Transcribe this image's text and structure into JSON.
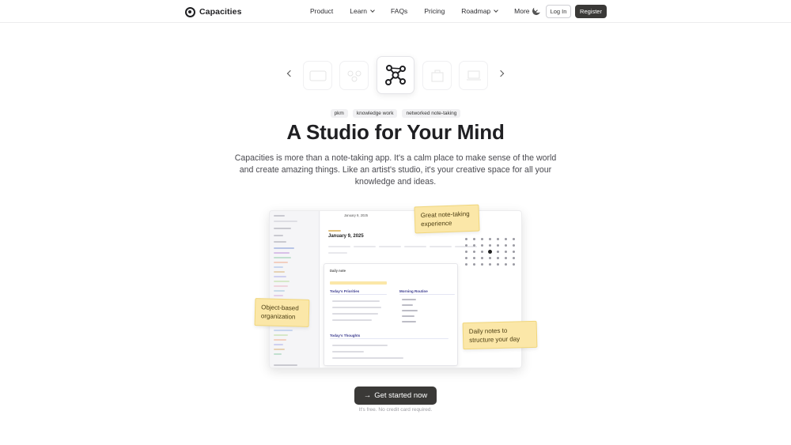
{
  "brand": {
    "name": "Capacities"
  },
  "nav": {
    "items": [
      {
        "label": "Product",
        "dropdown": false
      },
      {
        "label": "Learn",
        "dropdown": true
      },
      {
        "label": "FAQs",
        "dropdown": false
      },
      {
        "label": "Pricing",
        "dropdown": false
      },
      {
        "label": "Roadmap",
        "dropdown": true
      },
      {
        "label": "More",
        "dropdown": true
      }
    ],
    "login_label": "Log In",
    "register_label": "Register"
  },
  "hero": {
    "tags": [
      "pkm",
      "knowledge work",
      "networked note-taking"
    ],
    "title": "A Studio for Your Mind",
    "description": "Capacities is more than a note-taking app. It's a calm place to make sense of the world and create amazing things. Like an artist's studio, it's your creative space for all your knowledge and ideas."
  },
  "preview": {
    "date_heading": "January 9, 2025",
    "crumb": "January 9, 2025",
    "sections": {
      "priorities": "Today's Priorities",
      "routine": "Morning Routine",
      "thoughts": "Today's Thoughts",
      "daily": "Daily note"
    }
  },
  "stickies": {
    "top": "Great note-taking experience",
    "left": "Object-based organization",
    "right": "Daily notes to structure your day"
  },
  "cta": {
    "label": "Get started now",
    "note": "It's free. No credit card required."
  },
  "colors": {
    "accent": "#3a3937",
    "sticky": "#fbe7a8"
  }
}
